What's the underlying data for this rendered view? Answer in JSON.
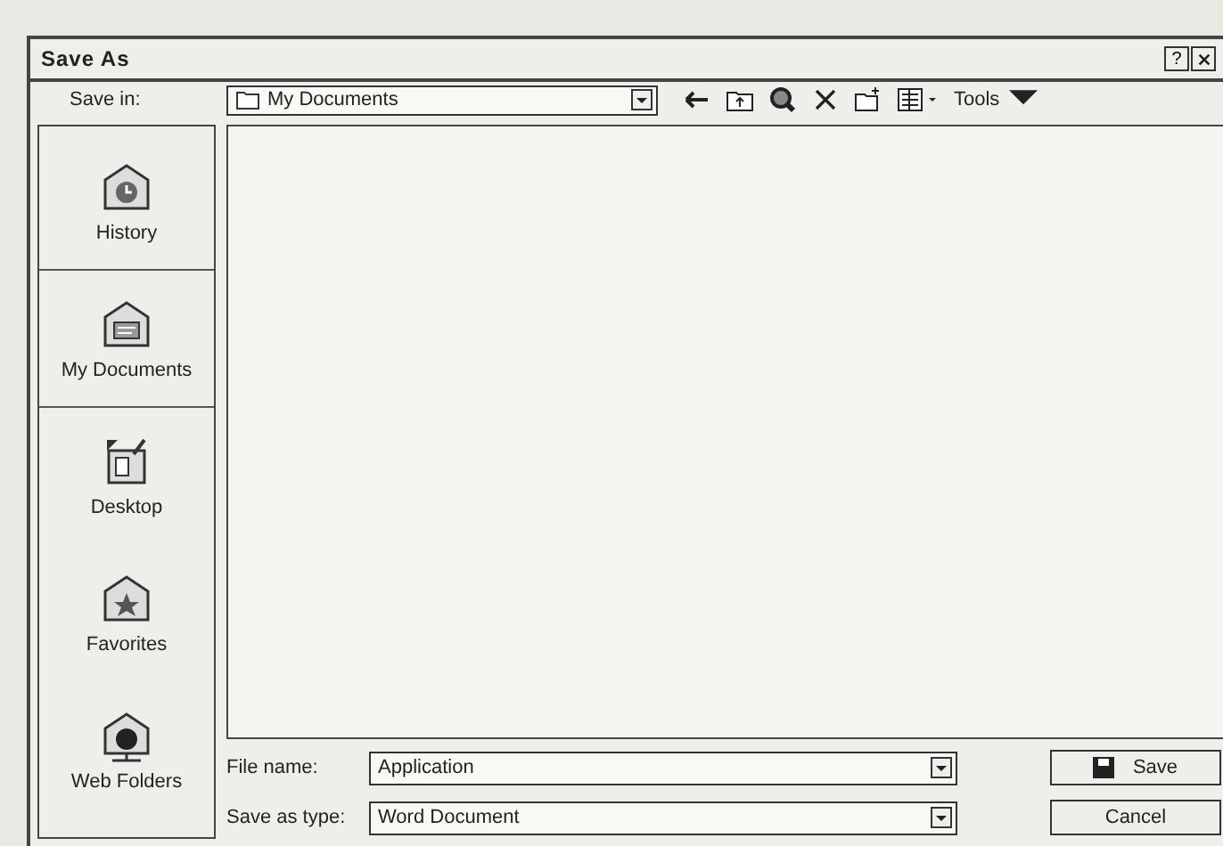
{
  "window": {
    "title": "Save As",
    "help": "?"
  },
  "save_in": {
    "label": "Save in:",
    "value": "My Documents"
  },
  "toolbar": {
    "tools": "Tools"
  },
  "places": [
    {
      "label": "History",
      "kind": "history"
    },
    {
      "label": "My Documents",
      "kind": "documents"
    },
    {
      "label": "Desktop",
      "kind": "desktop"
    },
    {
      "label": "Favorites",
      "kind": "favorites"
    },
    {
      "label": "Web Folders",
      "kind": "web"
    }
  ],
  "file_name": {
    "label": "File name:",
    "value": "Application"
  },
  "save_as_type": {
    "label": "Save as type:",
    "value": "Word Document"
  },
  "buttons": [
    {
      "label": "Save",
      "kind": "save"
    },
    {
      "label": "Cancel",
      "kind": "cancel"
    }
  ]
}
